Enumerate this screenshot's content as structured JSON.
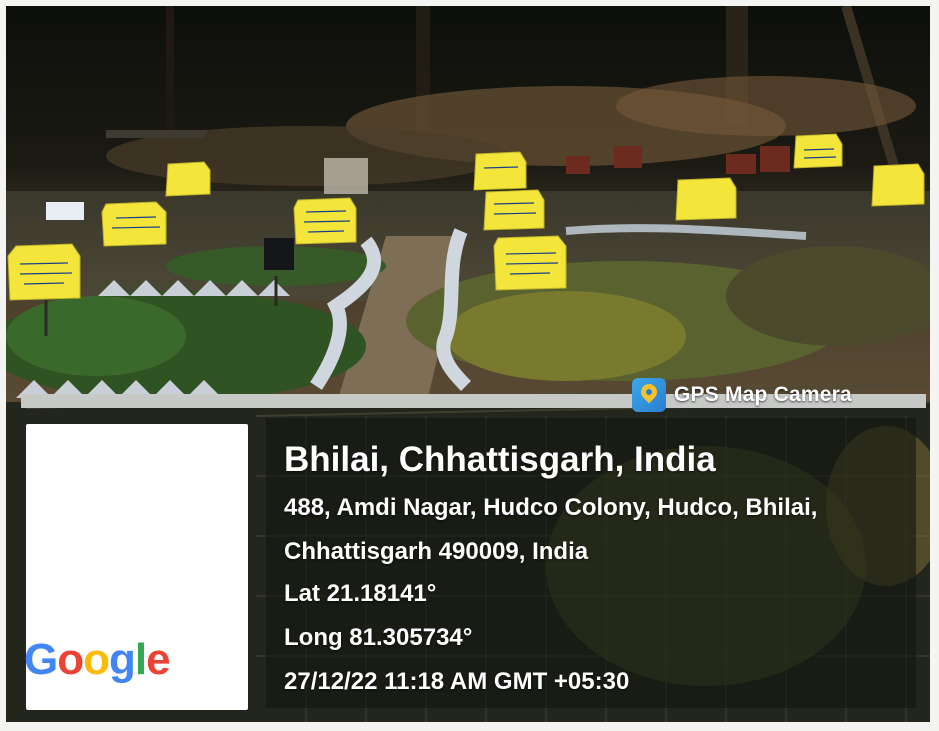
{
  "watermark": {
    "icon": "gps-map-camera-icon",
    "label": "GPS Map Camera"
  },
  "map": {
    "logo_letters": [
      {
        "ch": "G",
        "color": "#4285F4"
      },
      {
        "ch": "o",
        "color": "#EA4335"
      },
      {
        "ch": "o",
        "color": "#FBBC05"
      },
      {
        "ch": "g",
        "color": "#4285F4"
      },
      {
        "ch": "l",
        "color": "#34A853"
      },
      {
        "ch": "e",
        "color": "#EA4335"
      }
    ]
  },
  "location": {
    "title": "Bhilai, Chhattisgarh, India",
    "address_line1": "488, Amdi Nagar, Hudco Colony, Hudco, Bhilai,",
    "address_line2": "Chhattisgarh 490009, India",
    "lat": "Lat 21.18141°",
    "long": "Long 81.305734°",
    "datetime": "27/12/22 11:18 AM GMT +05:30"
  },
  "colors": {
    "sign_yellow": "#f3e53a",
    "panel_bg": "#121612"
  }
}
